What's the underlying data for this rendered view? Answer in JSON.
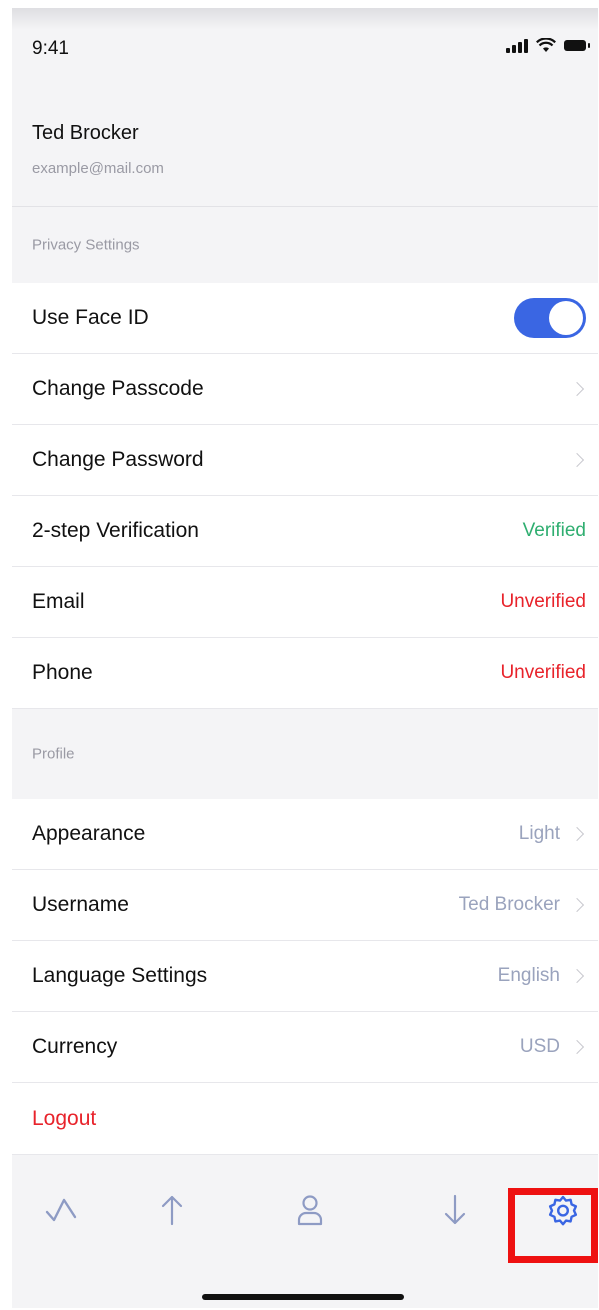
{
  "status_bar": {
    "time": "9:41"
  },
  "profile": {
    "name": "Ted Brocker",
    "email": "example@mail.com"
  },
  "privacy_section": {
    "header": "Privacy Settings",
    "rows": [
      {
        "label": "Use Face ID",
        "toggle_on": true
      },
      {
        "label": "Change Passcode"
      },
      {
        "label": "Change Password"
      },
      {
        "label": "2-step Verification",
        "value": "Verified",
        "value_color": "#2fae70"
      },
      {
        "label": "Email",
        "value": "Unverified",
        "value_color": "#e8232b"
      },
      {
        "label": "Phone",
        "value": "Unverified",
        "value_color": "#e8232b"
      }
    ]
  },
  "profile_section": {
    "header": "Profile",
    "rows": [
      {
        "label": "Appearance",
        "value": "Light"
      },
      {
        "label": "Username",
        "value": "Ted Brocker"
      },
      {
        "label": "Language Settings",
        "value": "English"
      },
      {
        "label": "Currency",
        "value": "USD"
      }
    ],
    "logout_label": "Logout"
  },
  "tab_bar": {
    "tabs": [
      {
        "icon": "chart-line-icon",
        "selected": false
      },
      {
        "icon": "arrow-up-icon",
        "selected": false
      },
      {
        "icon": "user-icon",
        "selected": false
      },
      {
        "icon": "arrow-down-icon",
        "selected": false
      },
      {
        "icon": "settings-gear-icon",
        "selected": true,
        "highlighted": true
      }
    ]
  },
  "colors": {
    "accent": "#3a66e3",
    "muted_value": "#9aa3bd",
    "success": "#2fae70",
    "danger": "#e8232b",
    "icon_inactive": "#8e9bc4",
    "highlight_box": "#ee1111"
  }
}
